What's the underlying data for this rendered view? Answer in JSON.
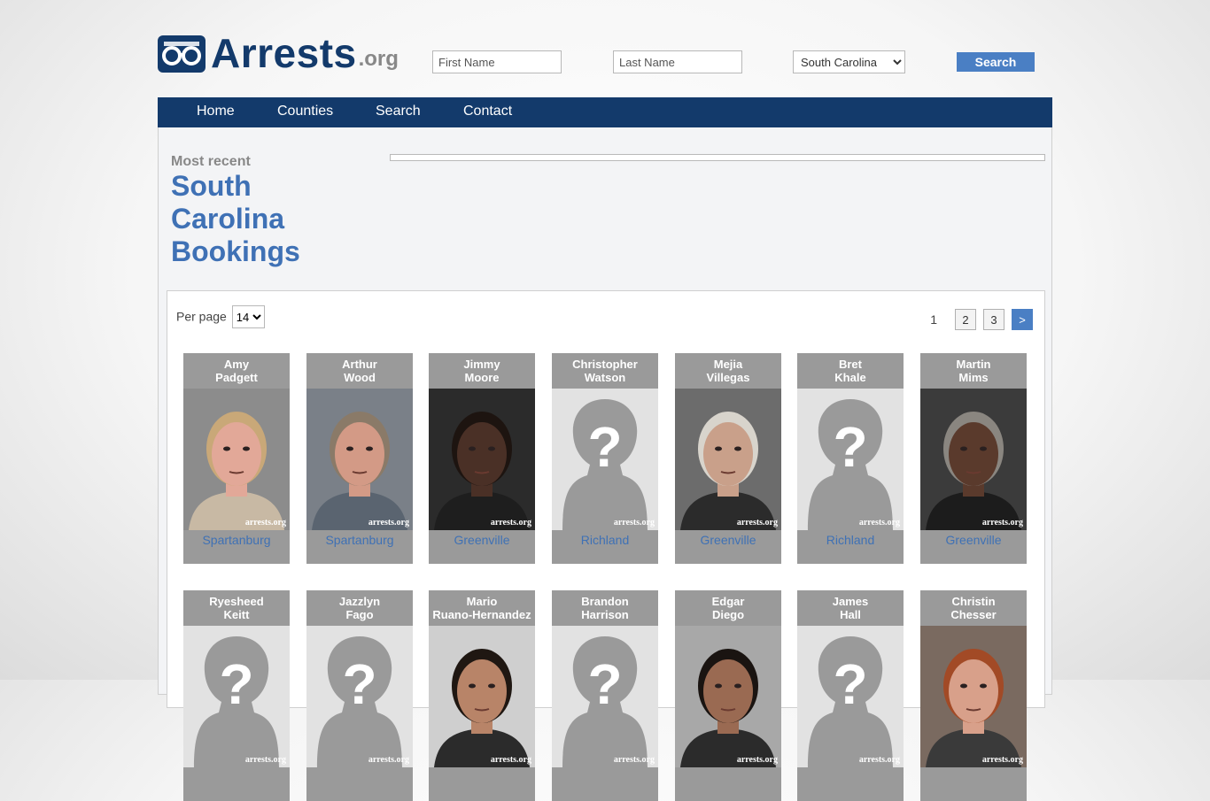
{
  "header": {
    "logo_text": "Arrests",
    "logo_suffix": ".org",
    "first_name_placeholder": "First Name",
    "last_name_placeholder": "Last Name",
    "state_selected": "South Carolina",
    "search_label": "Search"
  },
  "nav": [
    {
      "label": "Home"
    },
    {
      "label": "Counties"
    },
    {
      "label": "Search"
    },
    {
      "label": "Contact"
    }
  ],
  "main": {
    "most_recent": "Most recent",
    "title_lines": [
      "South",
      "Carolina",
      "Bookings"
    ],
    "per_page_label": "Per page",
    "per_page_value": "14",
    "pager": {
      "current": "1",
      "pages": [
        "2",
        "3"
      ],
      "next": ">"
    }
  },
  "photo_watermark": "arrests.org",
  "bookings": [
    {
      "first": "Amy",
      "last": "Padgett",
      "county": "Spartanburg",
      "photo": "mugshot",
      "skin": "#e2a898",
      "hair": "#c9a878",
      "bg": "#8c8c8c",
      "shirt": "#c8b9a4"
    },
    {
      "first": "Arthur",
      "last": "Wood",
      "county": "Spartanburg",
      "photo": "mugshot",
      "skin": "#d39a86",
      "hair": "#8a7a68",
      "bg": "#7a8088",
      "shirt": "#5a6470"
    },
    {
      "first": "Jimmy",
      "last": "Moore",
      "county": "Greenville",
      "photo": "mugshot",
      "skin": "#4a3026",
      "hair": "#1d1410",
      "bg": "#2b2b2b",
      "shirt": "#1e1e1e"
    },
    {
      "first": "Christopher",
      "last": "Watson",
      "county": "Richland",
      "photo": "placeholder"
    },
    {
      "first": "Mejia",
      "last": "Villegas",
      "county": "Greenville",
      "photo": "mugshot",
      "skin": "#c9a08a",
      "hair": "#d8d4cc",
      "bg": "#6c6c6c",
      "shirt": "#2b2b2b"
    },
    {
      "first": "Bret",
      "last": "Khale",
      "county": "Richland",
      "photo": "placeholder"
    },
    {
      "first": "Martin",
      "last": "Mims",
      "county": "Greenville",
      "photo": "mugshot",
      "skin": "#5a3a2c",
      "hair": "#8a8680",
      "bg": "#3b3b3b",
      "shirt": "#1c1c1c"
    },
    {
      "first": "Ryesheed",
      "last": "Keitt",
      "county": "",
      "photo": "placeholder"
    },
    {
      "first": "Jazzlyn",
      "last": "Fago",
      "county": "",
      "photo": "placeholder"
    },
    {
      "first": "Mario",
      "last": "Ruano-Hernandez",
      "county": "",
      "photo": "mugshot",
      "skin": "#b88468",
      "hair": "#1f1712",
      "bg": "#cfcfcf",
      "shirt": "#2b2b2b"
    },
    {
      "first": "Brandon",
      "last": "Harrison",
      "county": "",
      "photo": "placeholder"
    },
    {
      "first": "Edgar",
      "last": "Diego",
      "county": "",
      "photo": "mugshot",
      "skin": "#9a6a52",
      "hair": "#1a1411",
      "bg": "#a8a8a8",
      "shirt": "#2b2b2b"
    },
    {
      "first": "James",
      "last": "Hall",
      "county": "",
      "photo": "placeholder"
    },
    {
      "first": "Christin",
      "last": "Chesser",
      "county": "",
      "photo": "mugshot",
      "skin": "#d8a08a",
      "hair": "#a24a26",
      "bg": "#7a6a60",
      "shirt": "#3a3a3a"
    }
  ]
}
